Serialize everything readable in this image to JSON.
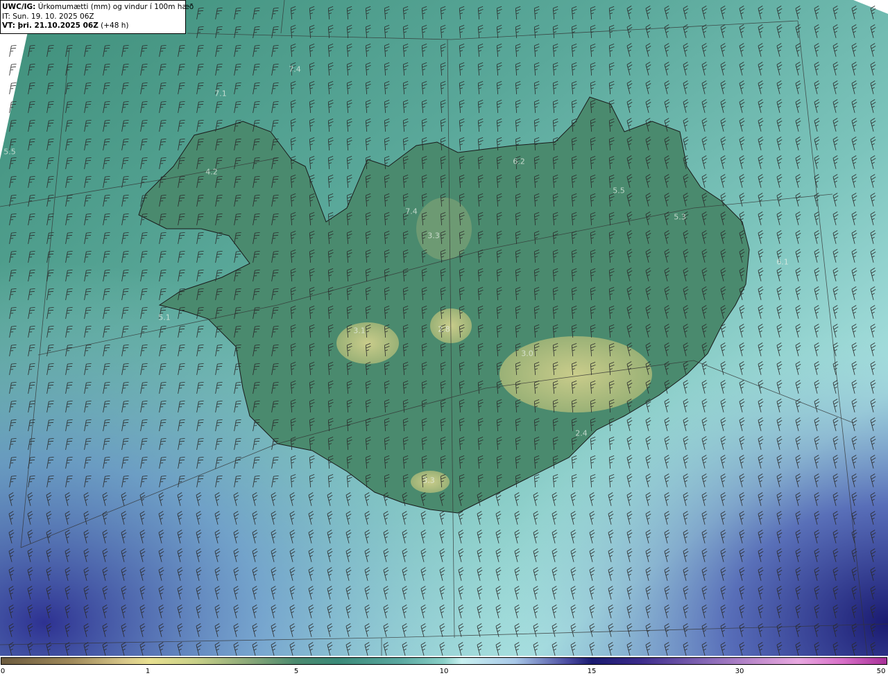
{
  "header": {
    "title_bold": "UWC/IG:",
    "title_rest": "Úrkomumætti (mm) og vindur í 100m hæð",
    "init_time": "IT: Sun. 19. 10. 2025 06Z",
    "valid_bold": "VT: þri. 21.10.2025 06Z",
    "valid_rest": "(+48 h)"
  },
  "map_labels": [
    {
      "text": "7.4"
    },
    {
      "text": "7.1"
    },
    {
      "text": "5.5"
    },
    {
      "text": "4.2"
    },
    {
      "text": "7.4"
    },
    {
      "text": "3.3"
    },
    {
      "text": "6.2"
    },
    {
      "text": "5.5"
    },
    {
      "text": "5.3"
    },
    {
      "text": "5.1"
    },
    {
      "text": "3.1"
    },
    {
      "text": "2.8"
    },
    {
      "text": "3.0"
    },
    {
      "text": "2.4"
    },
    {
      "text": "3.3"
    },
    {
      "text": "6.1"
    }
  ],
  "colorbar": {
    "ticks": [
      "0",
      "1",
      "5",
      "10",
      "15",
      "30",
      "50"
    ],
    "colors": {
      "dry": "#6b5a3e",
      "low": "#e8e090",
      "mid": "#3a8a78",
      "high": "#c8f0f0",
      "very_high": "#1a1a70",
      "extreme": "#a83098"
    }
  },
  "colors": {
    "land_high": "#c8c880",
    "land_mid": "#4a8a6e",
    "sea_near": "#5aa89a",
    "sea_far": "#a8e0e0",
    "sea_heavy": "#2a2a80",
    "barb": "#2a2a2a"
  }
}
